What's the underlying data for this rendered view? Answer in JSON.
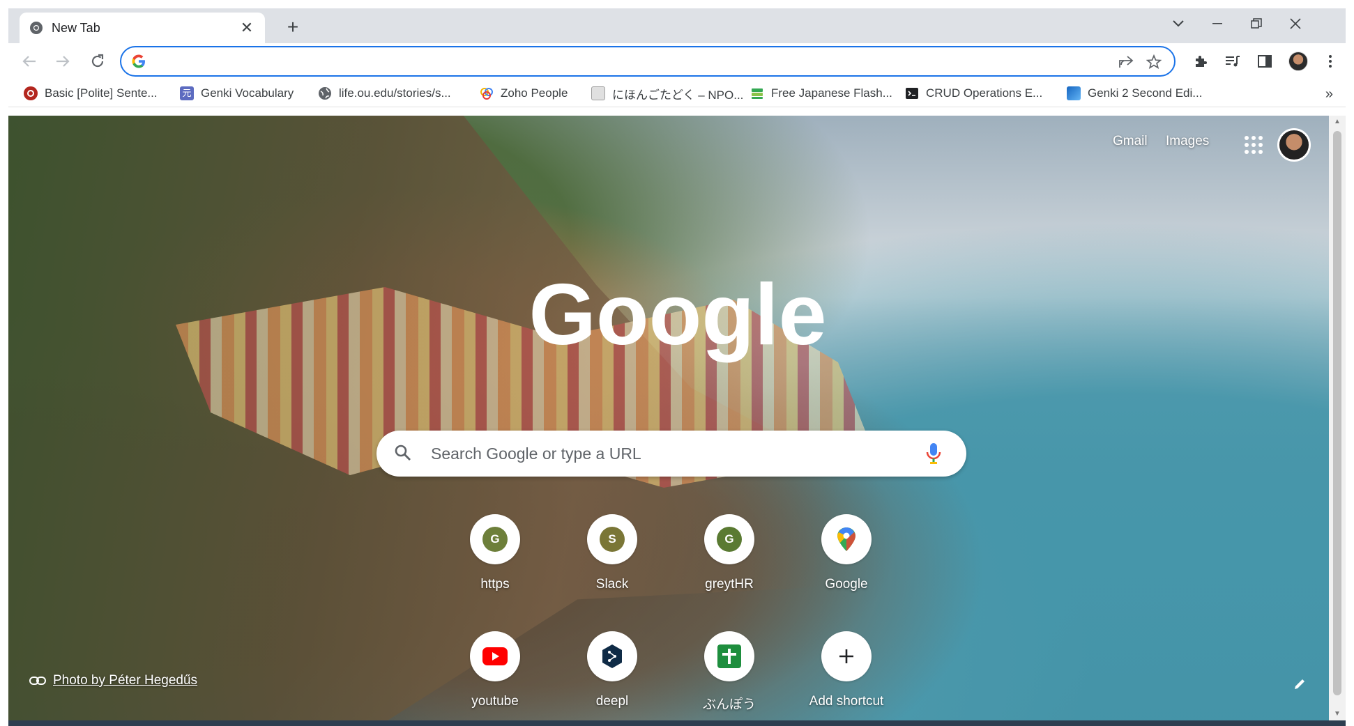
{
  "tab": {
    "title": "New Tab",
    "close_symbol": "✕",
    "new_tab_symbol": "+"
  },
  "window_controls": {
    "search_tabs": "⌵",
    "minimize": "—",
    "restore": "❐",
    "close": "✕"
  },
  "toolbar": {
    "back": "←",
    "forward": "→",
    "reload": "↻"
  },
  "omnibox": {
    "value": ""
  },
  "bookmarks": [
    {
      "label": "Basic [Polite] Sente...",
      "icon": "red-circle-icon",
      "color": "#b3261e"
    },
    {
      "label": "Genki Vocabulary",
      "icon": "genki-kanji-icon",
      "color": "#5c6bc0"
    },
    {
      "label": "life.ou.edu/stories/s...",
      "icon": "globe-icon",
      "color": "#5f6368"
    },
    {
      "label": "Zoho People",
      "icon": "zoho-icon",
      "color": "#f4b400"
    },
    {
      "label": "にほんごたどく – NPO...",
      "icon": "nihongo-icon",
      "color": "#9e9e9e"
    },
    {
      "label": "Free Japanese Flash...",
      "icon": "flashcard-icon",
      "color": "#34a853"
    },
    {
      "label": "CRUD Operations E...",
      "icon": "terminal-icon",
      "color": "#202124"
    },
    {
      "label": "Genki 2 Second Edi...",
      "icon": "genki-book-icon",
      "color": "#1565c0"
    }
  ],
  "bookmarks_more": "»",
  "ntp": {
    "links": {
      "gmail": "Gmail",
      "images": "Images"
    },
    "logo_text": "Google",
    "search_placeholder": "Search Google or type a URL",
    "shortcuts": [
      {
        "label": "https",
        "letter": "G",
        "color": "#6d7f3a"
      },
      {
        "label": "Slack",
        "letter": "S",
        "color": "#7a7636"
      },
      {
        "label": "greytHR",
        "letter": "G",
        "color": "#5a7a32"
      },
      {
        "label": "Google",
        "icon": "google-maps-icon"
      },
      {
        "label": "youtube",
        "icon": "youtube-icon"
      },
      {
        "label": "deepl",
        "icon": "deepl-icon"
      },
      {
        "label": "ぶんぽう",
        "icon": "bunpo-icon"
      },
      {
        "label": "Add shortcut",
        "icon": "plus-icon"
      }
    ],
    "photo_credit": "Photo by Péter Hegedűs"
  },
  "colors": {
    "accent": "#1a73e8",
    "tabstrip": "#dee1e6"
  }
}
